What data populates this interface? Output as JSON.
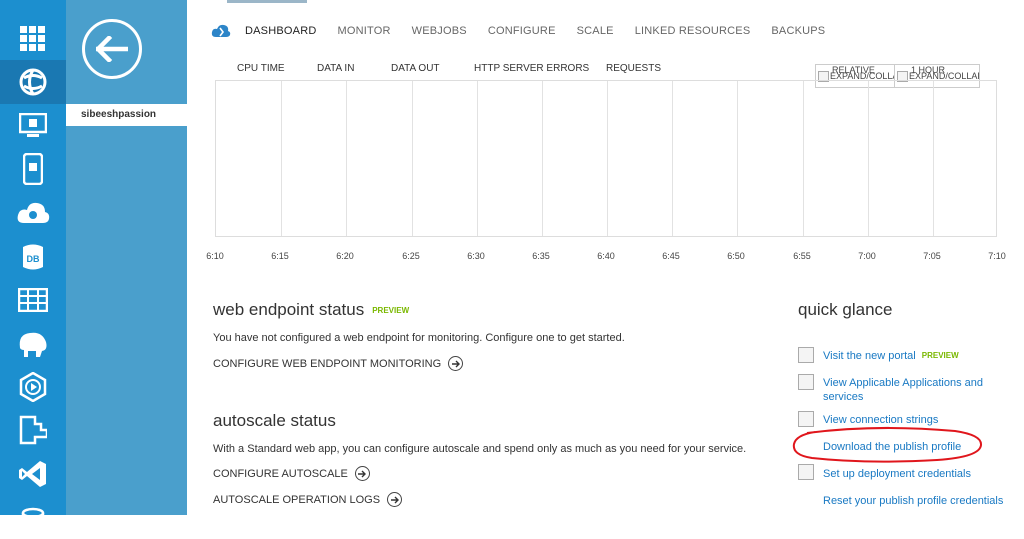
{
  "rail": {
    "items": [
      "apps-grid-icon",
      "web-apps-icon",
      "virtual-machines-icon",
      "mobile-services-icon",
      "cloud-services-icon",
      "sql-databases-icon",
      "storage-icon",
      "hdinsight-icon",
      "media-services-icon",
      "service-bus-icon",
      "visual-studio-icon",
      "database-icon"
    ]
  },
  "panel": {
    "site_name": "sibeeshpassion"
  },
  "tabs": [
    "DASHBOARD",
    "MONITOR",
    "WEBJOBS",
    "CONFIGURE",
    "SCALE",
    "LINKED RESOURCES",
    "BACKUPS"
  ],
  "metrics": [
    "CPU TIME",
    "DATA IN",
    "DATA OUT",
    "HTTP SERVER ERRORS",
    "REQUESTS"
  ],
  "dropdowns": {
    "relative": {
      "label": "RELATIVE",
      "alt": "EXPAND/COLLAPSE"
    },
    "range": {
      "label": "1 HOUR",
      "alt": "EXPAND/COLLAPSE"
    }
  },
  "chart_data": {
    "type": "line",
    "x": [
      "6:10",
      "6:15",
      "6:20",
      "6:25",
      "6:30",
      "6:35",
      "6:40",
      "6:45",
      "6:50",
      "6:55",
      "7:00",
      "7:05",
      "7:10"
    ],
    "series": []
  },
  "endpoint": {
    "title": "web endpoint status",
    "badge": "PREVIEW",
    "text": "You have not configured a web endpoint for monitoring. Configure one to get started.",
    "action": "CONFIGURE WEB ENDPOINT MONITORING"
  },
  "autoscale": {
    "title": "autoscale status",
    "text": "With a Standard web app, you can configure autoscale and spend only as much as you need for your service.",
    "action1": "CONFIGURE AUTOSCALE",
    "action2": "AUTOSCALE OPERATION LOGS"
  },
  "quick_glance": {
    "title": "quick glance",
    "links": [
      {
        "label": "Visit the new portal",
        "badge": "PREVIEW"
      },
      {
        "label": "View Applicable Applications and services"
      },
      {
        "label": "View connection strings"
      },
      {
        "label": "Download the publish profile"
      },
      {
        "label": "Set up deployment credentials"
      },
      {
        "label": "Reset your publish profile credentials"
      }
    ]
  },
  "colors": {
    "rail": "#1c8fcf",
    "panel": "#4a9fcc",
    "link": "#1979c3",
    "preview": "#7ab800",
    "annotation": "#e0161c"
  }
}
